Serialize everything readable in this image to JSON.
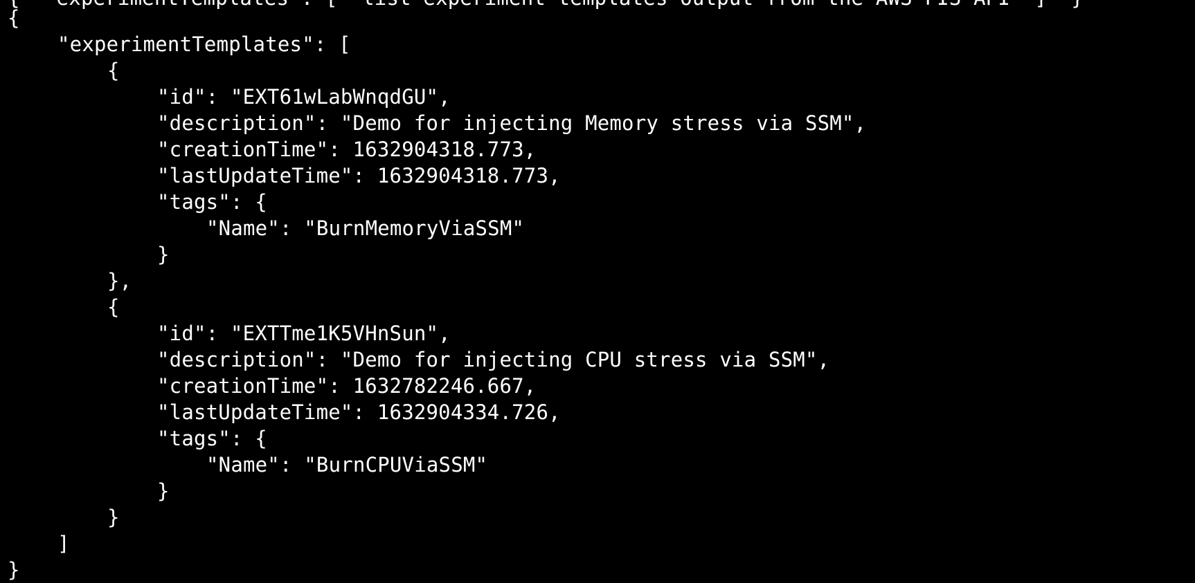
{
  "terminal": {
    "truncated_top_line": "{  \"experimentTemplates\": [  list-experiment-templates output from the AWS FIS API  ]  }",
    "lines": {
      "open_root": "{",
      "templates_key": "\"experimentTemplates\": [",
      "t1_open": "{",
      "t1_id": "\"id\": \"EXT61wLabWnqdGU\",",
      "t1_description": "\"description\": \"Demo for injecting Memory stress via SSM\",",
      "t1_creation": "\"creationTime\": 1632904318.773,",
      "t1_last_update": "\"lastUpdateTime\": 1632904318.773,",
      "t1_tags_open": "\"tags\": {",
      "t1_tag_name": "\"Name\": \"BurnMemoryViaSSM\"",
      "t1_tags_close": "}",
      "t1_close": "},",
      "t2_open": "{",
      "t2_id": "\"id\": \"EXTTme1K5VHnSun\",",
      "t2_description": "\"description\": \"Demo for injecting CPU stress via SSM\",",
      "t2_creation": "\"creationTime\": 1632782246.667,",
      "t2_last_update": "\"lastUpdateTime\": 1632904334.726,",
      "t2_tags_open": "\"tags\": {",
      "t2_tag_name": "\"Name\": \"BurnCPUViaSSM\"",
      "t2_tags_close": "}",
      "t2_close": "}",
      "templates_close": "]",
      "close_root": "}"
    }
  }
}
